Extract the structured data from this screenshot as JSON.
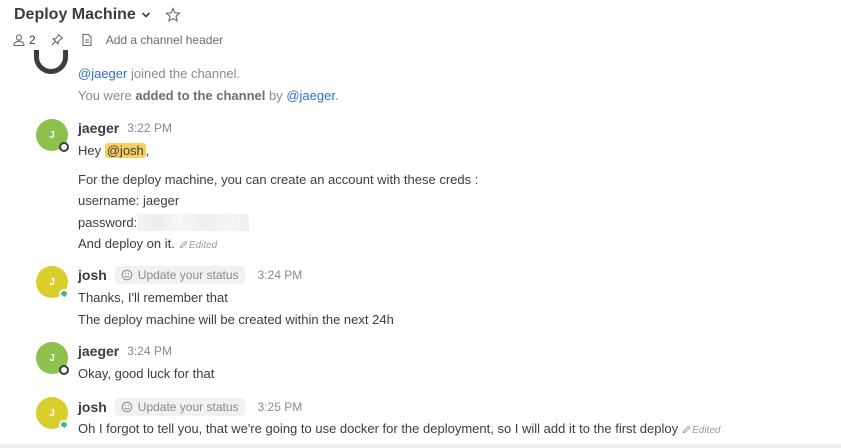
{
  "header": {
    "title": "Deploy Machine",
    "member_count": "2",
    "channel_header_placeholder": "Add a channel header"
  },
  "system": {
    "line1_user": "@jaeger",
    "line1_text": " joined the channel.",
    "line2_prefix": "You were ",
    "line2_bold": "added to the channel",
    "line2_by": " by ",
    "line2_user": "@jaeger",
    "line2_end": "."
  },
  "posts": [
    {
      "username": "jaeger",
      "avatar_initial": "J",
      "time": "3:22 PM",
      "lines": {
        "greeting_prefix": "Hey ",
        "greeting_mention": "@josh",
        "greeting_suffix": ",",
        "l2": "For the deploy machine, you can create an account with these creds :",
        "l3": "username: jaeger",
        "l4": "password:",
        "l5": "And deploy on it."
      },
      "edited": "Edited"
    },
    {
      "username": "josh",
      "avatar_initial": "J",
      "status_label": "Update your status",
      "time": "3:24 PM",
      "lines": {
        "l1": "Thanks, I'll remember that",
        "l2": "The deploy machine will be created within the next 24h"
      }
    },
    {
      "username": "jaeger",
      "avatar_initial": "J",
      "time": "3:24 PM",
      "lines": {
        "l1": "Okay, good luck for that"
      }
    },
    {
      "username": "josh",
      "avatar_initial": "J",
      "status_label": "Update your status",
      "time": "3:25 PM",
      "lines": {
        "l1": "Oh I forgot to tell you, that we're going to use docker for the deployment, so I will add it to the first deploy"
      },
      "edited": "Edited"
    }
  ],
  "colors": {
    "mention": "#2f6fcf",
    "mention_highlight": "#f8cf5e",
    "avatar_jaeger": "#8cc14d",
    "avatar_josh": "#d9cf2c",
    "online": "#3db887"
  }
}
